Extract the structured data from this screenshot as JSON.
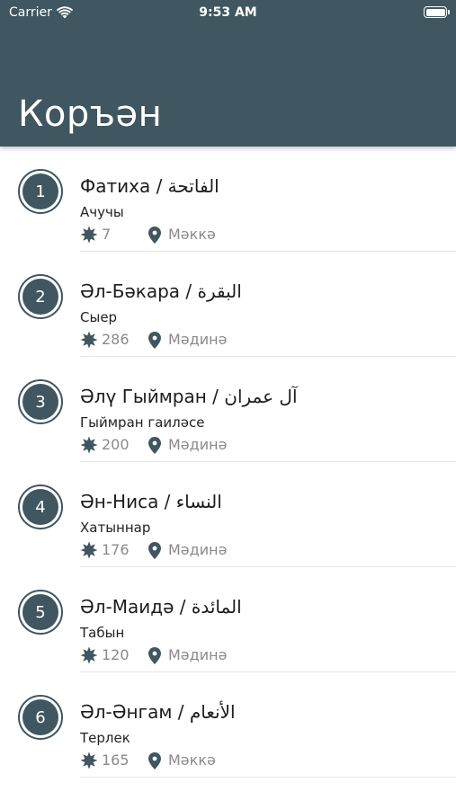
{
  "status_bar": {
    "carrier": "Carrier",
    "time": "9:53 AM"
  },
  "header": {
    "title": "Коръән",
    "background_color": "#405660"
  },
  "icons": {
    "ayah": "star-burst-icon",
    "place": "location-pin-icon"
  },
  "surahs": [
    {
      "number": "1",
      "title": "Фатиха / الفاتحة",
      "subtitle": "Ачучы",
      "ayah_count": "7",
      "place": "Мәккә"
    },
    {
      "number": "2",
      "title": "Әл-Бәкара / البقرة",
      "subtitle": "Сыер",
      "ayah_count": "286",
      "place": "Мәдинә"
    },
    {
      "number": "3",
      "title": "Әлү Гыймран / آل عمران",
      "subtitle": "Гыймран гаиләсе",
      "ayah_count": "200",
      "place": "Мәдинә"
    },
    {
      "number": "4",
      "title": "Ән-Ниса / النساء",
      "subtitle": "Хатыннар",
      "ayah_count": "176",
      "place": "Мәдинә"
    },
    {
      "number": "5",
      "title": "Әл-Маидә / المائدة",
      "subtitle": "Табын",
      "ayah_count": "120",
      "place": "Мәдинә"
    },
    {
      "number": "6",
      "title": "Әл-Әнгам / الأنعام",
      "subtitle": "Терлек",
      "ayah_count": "165",
      "place": "Мәккә"
    }
  ]
}
